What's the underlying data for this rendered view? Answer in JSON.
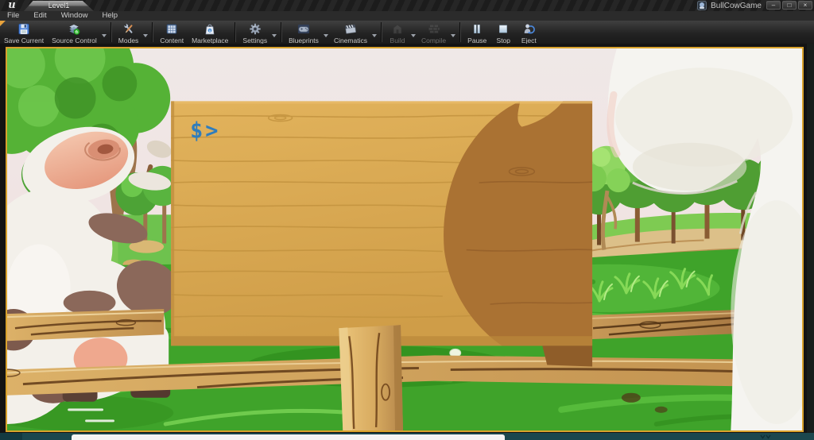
{
  "window": {
    "app_logo": "u",
    "tab_title": "Level1",
    "game_title": "BullCowGame",
    "controls": {
      "minimize": "–",
      "restore": "□",
      "close": "×"
    }
  },
  "menu_bar": {
    "items": [
      {
        "label": "File"
      },
      {
        "label": "Edit"
      },
      {
        "label": "Window"
      },
      {
        "label": "Help"
      }
    ]
  },
  "toolbar": {
    "buttons": [
      {
        "label": "Save Current",
        "icon": "floppy-disk-icon",
        "enabled": true,
        "dropdown": false
      },
      {
        "label": "Source Control",
        "icon": "layers-stack-icon",
        "enabled": true,
        "dropdown": true
      },
      {
        "label": "Modes",
        "icon": "wrench-pencil-icon",
        "enabled": true,
        "dropdown": true
      },
      {
        "label": "Content",
        "icon": "grid-drawer-icon",
        "enabled": true,
        "dropdown": false
      },
      {
        "label": "Marketplace",
        "icon": "shopping-bag-icon",
        "enabled": true,
        "dropdown": false
      },
      {
        "label": "Settings",
        "icon": "gear-icon",
        "enabled": true,
        "dropdown": true
      },
      {
        "label": "Blueprints",
        "icon": "gamepad-icon",
        "enabled": true,
        "dropdown": true
      },
      {
        "label": "Cinematics",
        "icon": "clapperboard-icon",
        "enabled": true,
        "dropdown": true
      },
      {
        "label": "Build",
        "icon": "building-icon",
        "enabled": false,
        "dropdown": true
      },
      {
        "label": "Compile",
        "icon": "bricks-icon",
        "enabled": false,
        "dropdown": true
      },
      {
        "label": "Pause",
        "icon": "pause-bars-icon",
        "enabled": true,
        "dropdown": false
      },
      {
        "label": "Stop",
        "icon": "stop-square-icon",
        "enabled": true,
        "dropdown": false
      },
      {
        "label": "Eject",
        "icon": "eject-person-icon",
        "enabled": true,
        "dropdown": false
      }
    ]
  },
  "viewport": {
    "terminal_prompt": "$>"
  },
  "colors": {
    "pie_border": "#d9a22c",
    "sign_wood": "#d8a94f",
    "sign_shadow": "#aa7233",
    "prompt_blue": "#2f7dbd",
    "grass_green": "#3fa32a",
    "sky_pink": "#f2dfdf",
    "taskbar_teal": "#1b474e"
  }
}
